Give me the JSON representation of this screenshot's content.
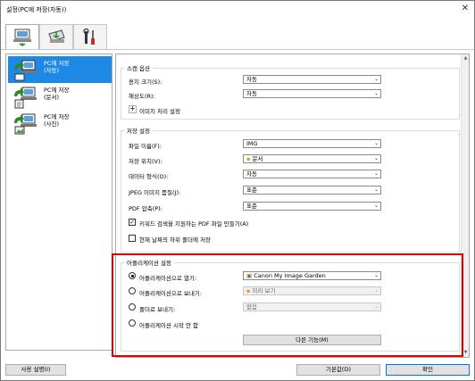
{
  "window": {
    "title": "설정(PC에 저장(자동))",
    "close_glyph": "✕"
  },
  "tabs": [
    {
      "name": "scan-from-computer",
      "icon": "computer-scan-icon"
    },
    {
      "name": "scan-from-panel",
      "icon": "scanner-panel-icon"
    },
    {
      "name": "general-settings",
      "icon": "tools-icon"
    }
  ],
  "sidebar": {
    "items": [
      {
        "label": "PC에 저장\n(자동)",
        "icon": "save-auto-icon",
        "active": true
      },
      {
        "label": "PC에 저장\n(문서)",
        "icon": "save-document-icon",
        "active": false
      },
      {
        "label": "PC에 저장\n(사진)",
        "icon": "save-photo-icon",
        "active": false
      }
    ]
  },
  "scan_options": {
    "title": "스캔 옵션",
    "paper_size_label": "용지 크기(S):",
    "paper_size_value": "자동",
    "resolution_label": "해상도(R):",
    "resolution_value": "자동",
    "image_processing_label": "이미지 처리 설정",
    "plus_glyph": "+"
  },
  "save_settings": {
    "title": "저장 설정",
    "file_name_label": "파일 이름(F):",
    "file_name_value": "IMG",
    "save_in_label": "저장 위치(V):",
    "save_in_value": "문서",
    "data_format_label": "데이터 형식(O):",
    "data_format_value": "자동",
    "jpeg_quality_label": "JPEG 이미지 품질(J):",
    "jpeg_quality_value": "표준",
    "pdf_compression_label": "PDF 압축(P):",
    "pdf_compression_value": "표준",
    "keyword_pdf_label": "키워드 검색을 지원하는 PDF 파일 만들기(A)",
    "keyword_pdf_checked": true,
    "subfolder_label": "현재 날짜의 하위 폴더에 저장",
    "subfolder_checked": false,
    "check_glyph": "✓"
  },
  "app_settings": {
    "title": "어플리케이션 설정",
    "open_app_label": "어플리케이션으로 열기:",
    "open_app_value": "Canon My Image Garden",
    "send_app_label": "어플리케이션으로 보내기:",
    "send_app_value": "미리 보기",
    "send_folder_label": "폴더로 보내기:",
    "send_folder_value": "없음",
    "no_app_label": "어플리케이션 시작 안 함",
    "more_functions_label": "다른 기능(M)",
    "selected_option": "open_app"
  },
  "footer": {
    "instructions_label": "사용 설명(I)",
    "defaults_label": "기본값(D)",
    "ok_label": "확인"
  },
  "colors": {
    "accent": "#1e88e5",
    "highlight_border": "#e00000"
  }
}
